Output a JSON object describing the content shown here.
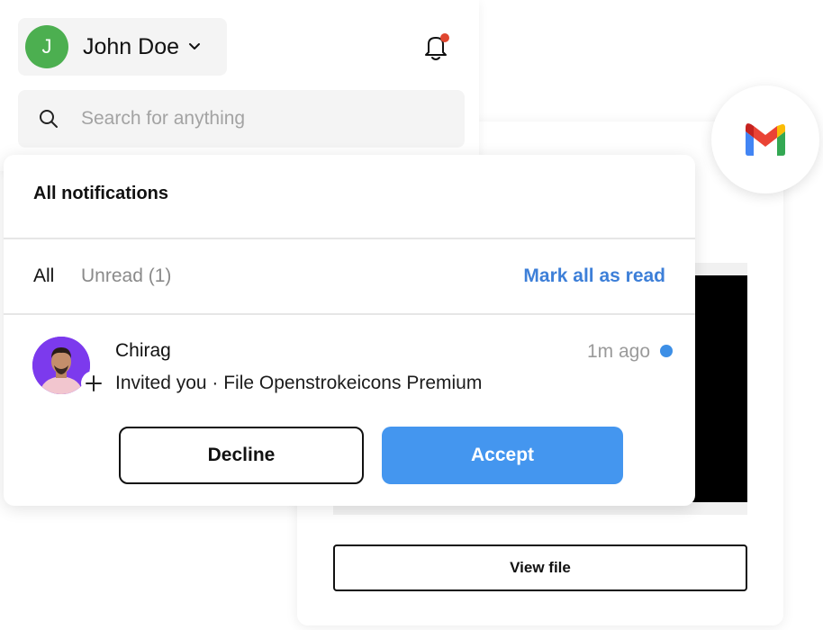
{
  "user": {
    "initial": "J",
    "name": "John Doe"
  },
  "search": {
    "placeholder": "Search for anything"
  },
  "notifications": {
    "title": "All notifications",
    "tabs": {
      "all": "All",
      "unread": "Unread (1)"
    },
    "mark_all_label": "Mark all as read",
    "items": [
      {
        "sender": "Chirag",
        "message": "Invited you · File Openstrokeicons Premium",
        "time": "1m ago",
        "unread": true,
        "decline_label": "Decline",
        "accept_label": "Accept"
      }
    ]
  },
  "file_card": {
    "view_label": "View file"
  },
  "colors": {
    "accent_blue": "#4496ef",
    "link_blue": "#3d7fd8",
    "avatar_green": "#4caf50",
    "notification_dot": "#e0462f",
    "unread_dot": "#3d8fe6"
  },
  "icons": [
    "chevron-down-icon",
    "bell-icon",
    "search-icon",
    "gmail-icon",
    "plus-icon"
  ]
}
